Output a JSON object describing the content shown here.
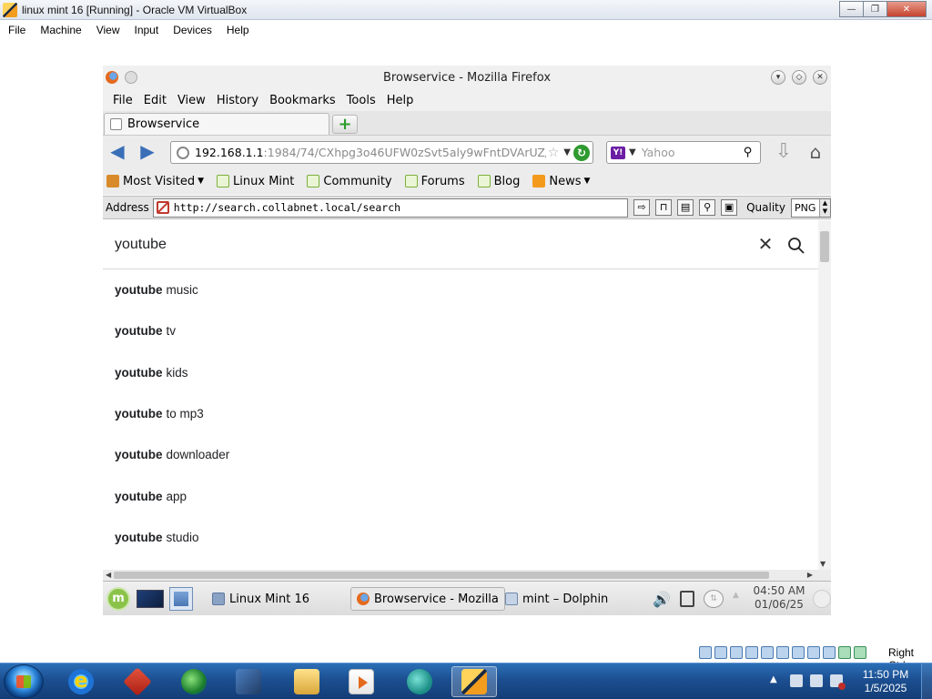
{
  "vbox": {
    "title": "linux mint 16 [Running] - Oracle VM VirtualBox",
    "menu": [
      "File",
      "Machine",
      "View",
      "Input",
      "Devices",
      "Help"
    ],
    "host_key": "Right Ctrl"
  },
  "firefox": {
    "title": "Browservice - Mozilla Firefox",
    "menu": [
      "File",
      "Edit",
      "View",
      "History",
      "Bookmarks",
      "Tools",
      "Help"
    ],
    "tab_label": "Browservice",
    "url_host": "192.168.1.1",
    "url_path": ":1984/74/CXhpg3o46UFW0zSvt5aly9wFntDVArUZ/",
    "search_placeholder": "Yahoo",
    "bookmarks": [
      {
        "label": "Most Visited",
        "icon": "folder-icon",
        "dropdown": true
      },
      {
        "label": "Linux Mint",
        "icon": "mint-icon",
        "dropdown": false
      },
      {
        "label": "Community",
        "icon": "mint-icon",
        "dropdown": false
      },
      {
        "label": "Forums",
        "icon": "mint-icon",
        "dropdown": false
      },
      {
        "label": "Blog",
        "icon": "mint-icon",
        "dropdown": false
      },
      {
        "label": "News",
        "icon": "rss-icon",
        "dropdown": true
      }
    ]
  },
  "browservice": {
    "address_label": "Address",
    "address_url": "http://search.collabnet.local/search",
    "quality_label": "Quality",
    "quality_value": "PNG"
  },
  "page": {
    "query": "youtube",
    "suggestions": [
      {
        "bold": "youtube",
        "rest": "music"
      },
      {
        "bold": "youtube",
        "rest": "tv"
      },
      {
        "bold": "youtube",
        "rest": "kids"
      },
      {
        "bold": "youtube",
        "rest": "to mp3"
      },
      {
        "bold": "youtube",
        "rest": "downloader"
      },
      {
        "bold": "youtube",
        "rest": "app"
      },
      {
        "bold": "youtube",
        "rest": "studio"
      }
    ]
  },
  "mint_panel": {
    "tasks": [
      "Linux Mint 16",
      "Browservice - Mozilla",
      "mint – Dolphin"
    ],
    "time": "04:50 AM",
    "date": "01/06/25"
  },
  "windows": {
    "time": "11:50 PM",
    "date": "1/5/2025"
  },
  "colors": {
    "win_taskbar": "#1c4f91",
    "firefox_chrome": "#ececec",
    "mint_green": "#8bc34a"
  }
}
